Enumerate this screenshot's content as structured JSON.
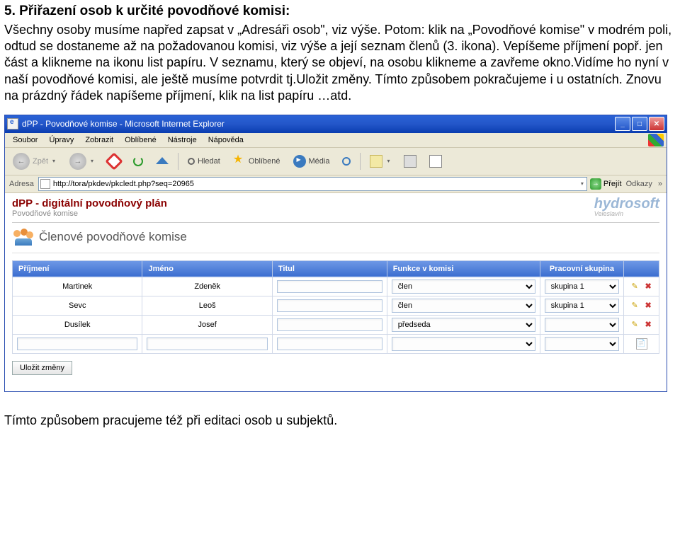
{
  "doc": {
    "heading": "5. Přiřazení osob k určité povodňové komisi:",
    "body": "Všechny osoby musíme napřed zapsat v „Adresáři osob\", viz výše. Potom: klik na „Povodňové komise\" v modrém poli, odtud se dostaneme až na požadovanou komisi, viz výše a její seznam členů (3. ikona). Vepíšeme příjmení popř. jen část a klikneme na ikonu list papíru. V seznamu, který se objeví, na osobu klikneme a zavřeme okno.Vidíme ho nyní v naší povodňové komisi, ale ještě musíme potvrdit tj.Uložit změny. Tímto způsobem pokračujeme i u ostatních. Znovu na prázdný řádek napíšeme příjmení, klik na list papíru …atd.",
    "footer": "Tímto způsobem pracujeme též při editaci osob u subjektů."
  },
  "window": {
    "title": "dPP - Povodňové komise - Microsoft Internet Explorer"
  },
  "menu": {
    "items": [
      "Soubor",
      "Úpravy",
      "Zobrazit",
      "Oblíbené",
      "Nástroje",
      "Nápověda"
    ]
  },
  "toolbar": {
    "back": "Zpět",
    "search": "Hledat",
    "favorites": "Oblíbené",
    "media": "Média"
  },
  "address": {
    "label": "Adresa",
    "url": "http://tora/pkdev/pkcledt.php?seq=20965",
    "go": "Přejít",
    "links": "Odkazy"
  },
  "page": {
    "title": "dPP - digitální povodňový plán",
    "subtitle": "Povodňové komise",
    "logo": "hydrosoft",
    "logo_sub": "Veleslavín",
    "section": "Členové povodňové komise",
    "columns": {
      "prijmeni": "Příjmení",
      "jmeno": "Jméno",
      "titul": "Titul",
      "funkce": "Funkce v komisi",
      "skupina": "Pracovní skupina"
    },
    "rows": [
      {
        "prijmeni": "Martinek",
        "jmeno": "Zdeněk",
        "titul": "",
        "funkce": "člen",
        "skupina": "skupina 1"
      },
      {
        "prijmeni": "Sevc",
        "jmeno": "Leoš",
        "titul": "",
        "funkce": "člen",
        "skupina": "skupina 1"
      },
      {
        "prijmeni": "Dusílek",
        "jmeno": "Josef",
        "titul": "",
        "funkce": "předseda",
        "skupina": ""
      },
      {
        "prijmeni": "",
        "jmeno": "",
        "titul": "",
        "funkce": "",
        "skupina": ""
      }
    ],
    "save": "Uložit změny"
  }
}
